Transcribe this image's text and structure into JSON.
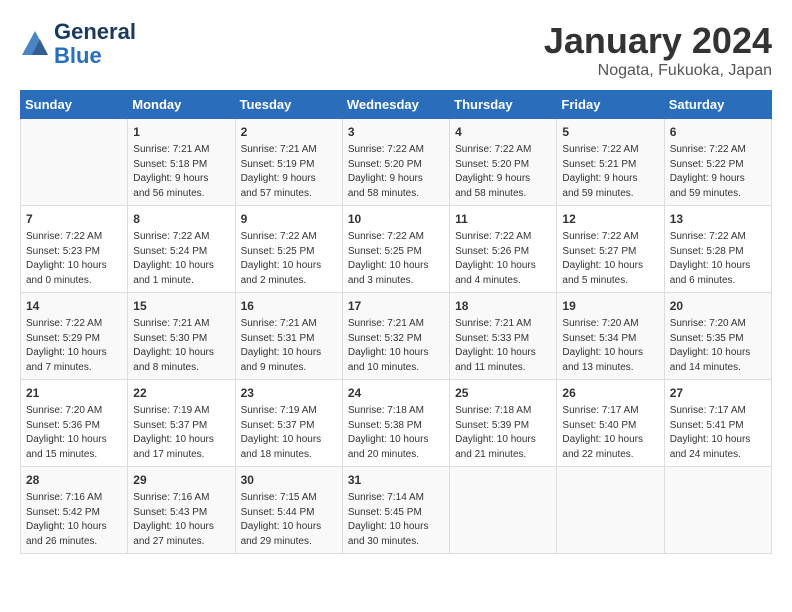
{
  "header": {
    "logo_line1": "General",
    "logo_line2": "Blue",
    "month": "January 2024",
    "location": "Nogata, Fukuoka, Japan"
  },
  "days_of_week": [
    "Sunday",
    "Monday",
    "Tuesday",
    "Wednesday",
    "Thursday",
    "Friday",
    "Saturday"
  ],
  "weeks": [
    [
      {
        "day": "",
        "info": ""
      },
      {
        "day": "1",
        "info": "Sunrise: 7:21 AM\nSunset: 5:18 PM\nDaylight: 9 hours\nand 56 minutes."
      },
      {
        "day": "2",
        "info": "Sunrise: 7:21 AM\nSunset: 5:19 PM\nDaylight: 9 hours\nand 57 minutes."
      },
      {
        "day": "3",
        "info": "Sunrise: 7:22 AM\nSunset: 5:20 PM\nDaylight: 9 hours\nand 58 minutes."
      },
      {
        "day": "4",
        "info": "Sunrise: 7:22 AM\nSunset: 5:20 PM\nDaylight: 9 hours\nand 58 minutes."
      },
      {
        "day": "5",
        "info": "Sunrise: 7:22 AM\nSunset: 5:21 PM\nDaylight: 9 hours\nand 59 minutes."
      },
      {
        "day": "6",
        "info": "Sunrise: 7:22 AM\nSunset: 5:22 PM\nDaylight: 9 hours\nand 59 minutes."
      }
    ],
    [
      {
        "day": "7",
        "info": "Sunrise: 7:22 AM\nSunset: 5:23 PM\nDaylight: 10 hours\nand 0 minutes."
      },
      {
        "day": "8",
        "info": "Sunrise: 7:22 AM\nSunset: 5:24 PM\nDaylight: 10 hours\nand 1 minute."
      },
      {
        "day": "9",
        "info": "Sunrise: 7:22 AM\nSunset: 5:25 PM\nDaylight: 10 hours\nand 2 minutes."
      },
      {
        "day": "10",
        "info": "Sunrise: 7:22 AM\nSunset: 5:25 PM\nDaylight: 10 hours\nand 3 minutes."
      },
      {
        "day": "11",
        "info": "Sunrise: 7:22 AM\nSunset: 5:26 PM\nDaylight: 10 hours\nand 4 minutes."
      },
      {
        "day": "12",
        "info": "Sunrise: 7:22 AM\nSunset: 5:27 PM\nDaylight: 10 hours\nand 5 minutes."
      },
      {
        "day": "13",
        "info": "Sunrise: 7:22 AM\nSunset: 5:28 PM\nDaylight: 10 hours\nand 6 minutes."
      }
    ],
    [
      {
        "day": "14",
        "info": "Sunrise: 7:22 AM\nSunset: 5:29 PM\nDaylight: 10 hours\nand 7 minutes."
      },
      {
        "day": "15",
        "info": "Sunrise: 7:21 AM\nSunset: 5:30 PM\nDaylight: 10 hours\nand 8 minutes."
      },
      {
        "day": "16",
        "info": "Sunrise: 7:21 AM\nSunset: 5:31 PM\nDaylight: 10 hours\nand 9 minutes."
      },
      {
        "day": "17",
        "info": "Sunrise: 7:21 AM\nSunset: 5:32 PM\nDaylight: 10 hours\nand 10 minutes."
      },
      {
        "day": "18",
        "info": "Sunrise: 7:21 AM\nSunset: 5:33 PM\nDaylight: 10 hours\nand 11 minutes."
      },
      {
        "day": "19",
        "info": "Sunrise: 7:20 AM\nSunset: 5:34 PM\nDaylight: 10 hours\nand 13 minutes."
      },
      {
        "day": "20",
        "info": "Sunrise: 7:20 AM\nSunset: 5:35 PM\nDaylight: 10 hours\nand 14 minutes."
      }
    ],
    [
      {
        "day": "21",
        "info": "Sunrise: 7:20 AM\nSunset: 5:36 PM\nDaylight: 10 hours\nand 15 minutes."
      },
      {
        "day": "22",
        "info": "Sunrise: 7:19 AM\nSunset: 5:37 PM\nDaylight: 10 hours\nand 17 minutes."
      },
      {
        "day": "23",
        "info": "Sunrise: 7:19 AM\nSunset: 5:37 PM\nDaylight: 10 hours\nand 18 minutes."
      },
      {
        "day": "24",
        "info": "Sunrise: 7:18 AM\nSunset: 5:38 PM\nDaylight: 10 hours\nand 20 minutes."
      },
      {
        "day": "25",
        "info": "Sunrise: 7:18 AM\nSunset: 5:39 PM\nDaylight: 10 hours\nand 21 minutes."
      },
      {
        "day": "26",
        "info": "Sunrise: 7:17 AM\nSunset: 5:40 PM\nDaylight: 10 hours\nand 22 minutes."
      },
      {
        "day": "27",
        "info": "Sunrise: 7:17 AM\nSunset: 5:41 PM\nDaylight: 10 hours\nand 24 minutes."
      }
    ],
    [
      {
        "day": "28",
        "info": "Sunrise: 7:16 AM\nSunset: 5:42 PM\nDaylight: 10 hours\nand 26 minutes."
      },
      {
        "day": "29",
        "info": "Sunrise: 7:16 AM\nSunset: 5:43 PM\nDaylight: 10 hours\nand 27 minutes."
      },
      {
        "day": "30",
        "info": "Sunrise: 7:15 AM\nSunset: 5:44 PM\nDaylight: 10 hours\nand 29 minutes."
      },
      {
        "day": "31",
        "info": "Sunrise: 7:14 AM\nSunset: 5:45 PM\nDaylight: 10 hours\nand 30 minutes."
      },
      {
        "day": "",
        "info": ""
      },
      {
        "day": "",
        "info": ""
      },
      {
        "day": "",
        "info": ""
      }
    ]
  ]
}
